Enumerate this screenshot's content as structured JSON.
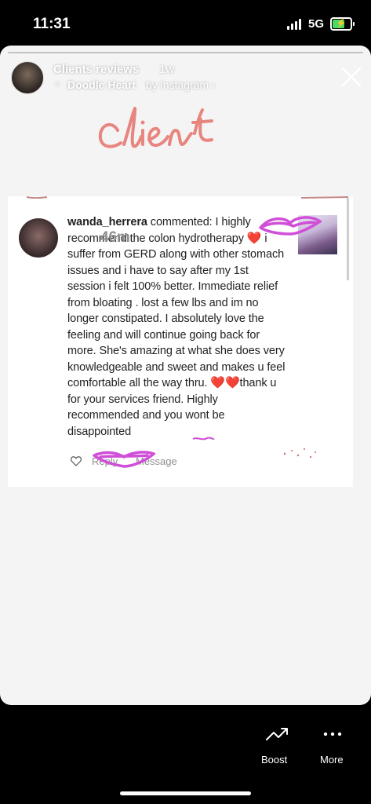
{
  "status": {
    "time": "11:31",
    "network": "5G"
  },
  "header": {
    "title": "Clients reviews",
    "age": "1w",
    "sticker_name": "Doodle Heart",
    "sticker_by": "by instagram ›"
  },
  "doodle_text": "client",
  "comment": {
    "username": "wanda_herrera",
    "text_a": " commented: I highly recommend the colon hydrotherapy ",
    "heart": "❤️",
    "text_b": " i suffer from GERD along with other stomach issues and i have to say after my 1st session i felt 100% better. Immediate relief from bloating . lost a few lbs and im no longer constipated. I absolutely love the feeling and will continue going back for more. She's amazing at what she does very knowledgeable and sweet and makes u feel comfortable all the way thru. ",
    "hearts_c": "❤️❤️",
    "text_c": "thank u for your services friend. Highly recommended and you wont be disappointed ",
    "time": "46m",
    "reply_label": "Reply",
    "message_label": "Message"
  },
  "bottom": {
    "boost_label": "Boost",
    "more_label": "More"
  },
  "colors": {
    "doodle": "#e8857f",
    "scribble": "#d04fd8",
    "battery": "#4cd964"
  }
}
